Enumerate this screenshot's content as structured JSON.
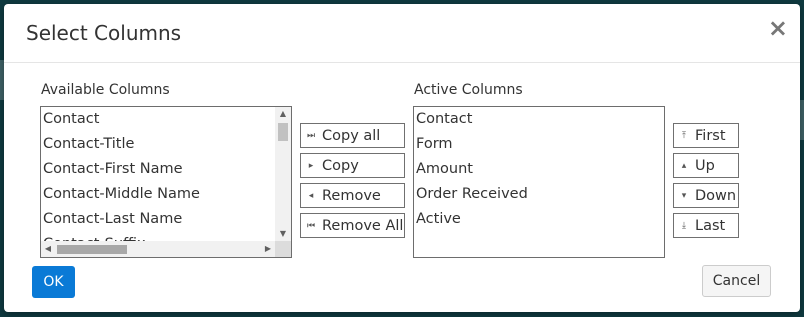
{
  "dialog": {
    "title": "Select Columns",
    "close_glyph": "×"
  },
  "available": {
    "label": "Available Columns",
    "items": [
      "Contact",
      "Contact-Title",
      "Contact-First Name",
      "Contact-Middle Name",
      "Contact-Last Name",
      "Contact-Suffix"
    ]
  },
  "active": {
    "label": "Active Columns",
    "items": [
      "Contact",
      "Form",
      "Amount",
      "Order Received",
      "Active"
    ]
  },
  "transfer_buttons": {
    "copy_all": "Copy all",
    "copy": "Copy",
    "remove": "Remove",
    "remove_all": "Remove All"
  },
  "order_buttons": {
    "first": "First",
    "up": "Up",
    "down": "Down",
    "last": "Last"
  },
  "footer": {
    "ok": "OK",
    "cancel": "Cancel"
  },
  "icons": {
    "copy_all": "double-right-skip-icon",
    "copy": "right-triangle-icon",
    "remove": "left-triangle-icon",
    "remove_all": "double-left-skip-icon",
    "first": "to-top-icon",
    "up": "up-triangle-icon",
    "down": "down-triangle-icon",
    "last": "to-bottom-icon"
  },
  "colors": {
    "backdrop": "#0f3a40",
    "primary": "#0a7ad6"
  }
}
